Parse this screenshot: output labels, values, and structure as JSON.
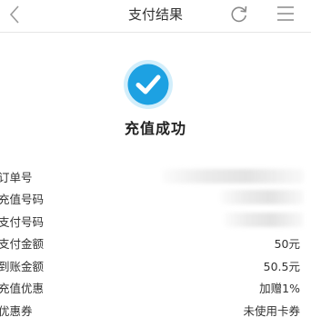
{
  "header": {
    "title": "支付结果",
    "back_icon": "chevron-left-icon",
    "refresh_icon": "refresh-icon",
    "menu_icon": "menu-icon"
  },
  "result": {
    "status_icon": "check-circle-icon",
    "status_text": "充值成功",
    "accent_color": "#1da1e2"
  },
  "details": {
    "order_number": {
      "label": "订单号",
      "value": ""
    },
    "recharge_number": {
      "label": "充值号码",
      "value": ""
    },
    "payment_number": {
      "label": "支付号码",
      "value": ""
    },
    "payment_amount": {
      "label": "支付金额",
      "value": "50元"
    },
    "credited_amount": {
      "label": "到账金额",
      "value": "50.5元"
    },
    "recharge_discount": {
      "label": "充值优惠",
      "value": "加赠1%"
    },
    "coupon": {
      "label": "优惠券",
      "value": "未使用卡券"
    }
  }
}
